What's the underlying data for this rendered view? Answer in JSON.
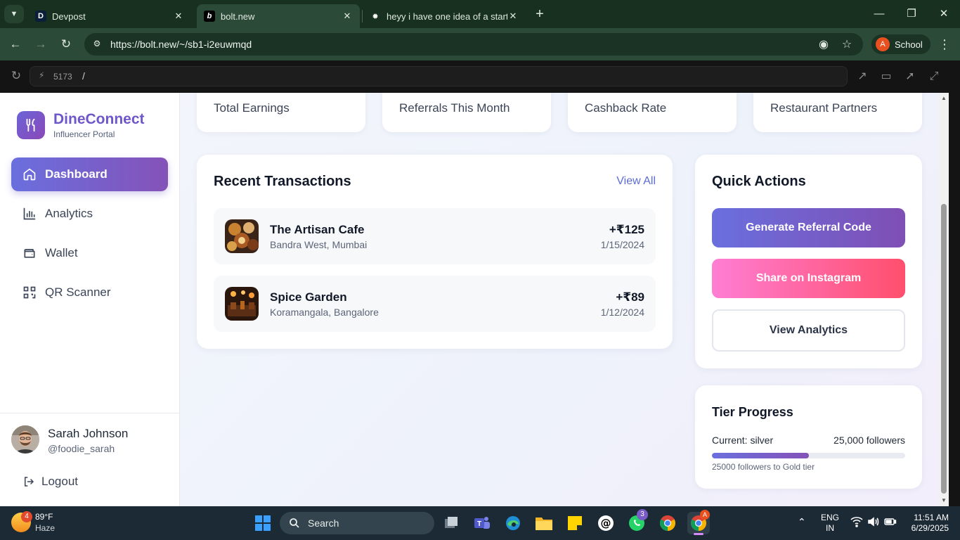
{
  "browser": {
    "tabs": [
      {
        "favicon": "D",
        "title": "Devpost"
      },
      {
        "favicon": "b",
        "title": "bolt.new"
      },
      {
        "favicon": "✹",
        "title": "heyy i have one idea of a startu"
      }
    ],
    "url": "https://bolt.new/~/sb1-i2euwmqd",
    "profile_initial": "A",
    "profile_label": "School"
  },
  "preview_bar": {
    "port": "5173",
    "path": "/"
  },
  "sidebar": {
    "brand": "DineConnect",
    "brand_sub": "Influencer Portal",
    "items": [
      {
        "label": "Dashboard",
        "icon": "home-icon"
      },
      {
        "label": "Analytics",
        "icon": "bar-chart-icon"
      },
      {
        "label": "Wallet",
        "icon": "wallet-icon"
      },
      {
        "label": "QR Scanner",
        "icon": "qr-code-icon"
      }
    ],
    "user": {
      "name": "Sarah Johnson",
      "handle": "@foodie_sarah"
    },
    "logout_label": "Logout"
  },
  "stats": [
    {
      "label": "Total Earnings"
    },
    {
      "label": "Referrals This Month"
    },
    {
      "label": "Cashback Rate"
    },
    {
      "label": "Restaurant Partners"
    }
  ],
  "transactions": {
    "title": "Recent Transactions",
    "view_all": "View All",
    "rows": [
      {
        "name": "The Artisan Cafe",
        "location": "Bandra West, Mumbai",
        "amount": "+₹125",
        "date": "1/15/2024"
      },
      {
        "name": "Spice Garden",
        "location": "Koramangala, Bangalore",
        "amount": "+₹89",
        "date": "1/12/2024"
      }
    ]
  },
  "quick_actions": {
    "title": "Quick Actions",
    "generate": "Generate Referral Code",
    "share": "Share on Instagram",
    "analytics": "View Analytics"
  },
  "tier": {
    "title": "Tier Progress",
    "current": "Current: silver",
    "followers": "25,000 followers",
    "progress_fraction": 0.5,
    "note": "25000 followers to Gold tier"
  },
  "taskbar": {
    "weather_temp": "89°F",
    "weather_desc": "Haze",
    "weather_badge": "4",
    "search_label": "Search",
    "whatsapp_badge": "3",
    "lang_top": "ENG",
    "lang_bottom": "IN",
    "time": "11:51 AM",
    "date": "6/29/2025"
  },
  "colors": {
    "accent": "#6a6fde",
    "accent_end": "#8552b8",
    "instagram_start": "#ff7ed3",
    "instagram_end": "#ff4f6d",
    "brand_text": "#6e57c9"
  }
}
